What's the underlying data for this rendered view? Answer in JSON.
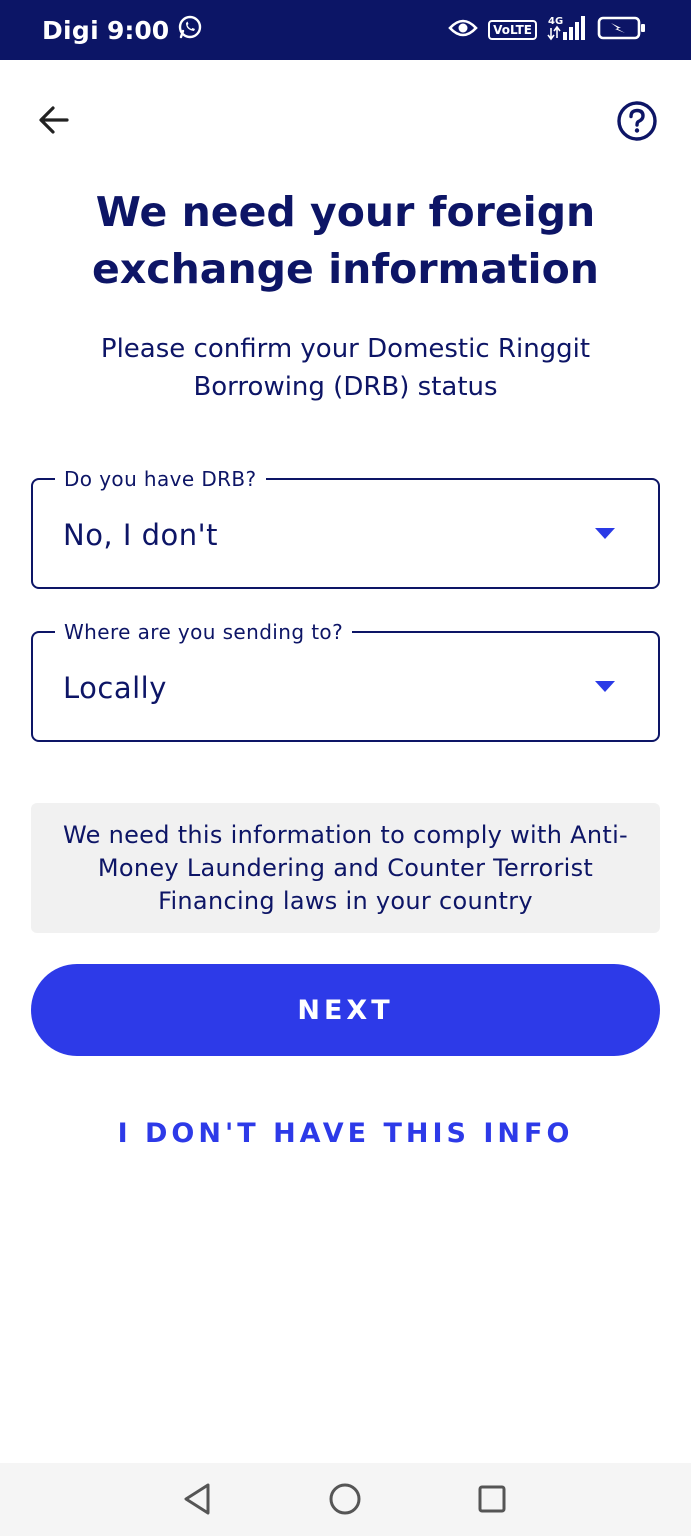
{
  "status_bar": {
    "carrier": "Digi",
    "time": "9:00",
    "icons": [
      "whatsapp-icon",
      "eye-icon",
      "volte-icon",
      "signal-icon",
      "battery-charging-icon"
    ],
    "volte_label": "VoLTE",
    "network_label": "4G"
  },
  "app_bar": {
    "back_icon": "arrow-left-icon",
    "help_icon": "help-circle-icon"
  },
  "page": {
    "title": "We need your foreign exchange information",
    "subtitle": "Please confirm your Domestic Ringgit Borrowing (DRB) status"
  },
  "form": {
    "drb": {
      "label": "Do you have DRB?",
      "value": "No, I don't"
    },
    "destination": {
      "label": "Where are you sending to?",
      "value": "Locally"
    }
  },
  "info": {
    "text": "We need this information to comply with Anti-Money Laundering and Counter Terrorist Financing laws in your country"
  },
  "actions": {
    "next_label": "NEXT",
    "no_info_label": "I DON'T HAVE THIS INFO"
  },
  "colors": {
    "status_bar": "#0c1566",
    "text_primary": "#0d1566",
    "accent": "#2d3ae8",
    "info_bg": "#f1f1f1"
  }
}
